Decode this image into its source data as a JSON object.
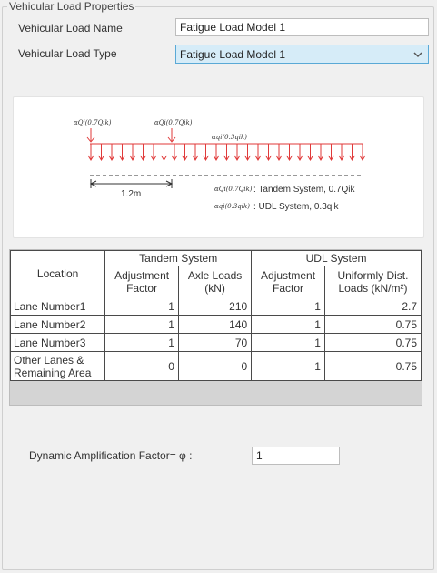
{
  "group": {
    "title": "Vehicular Load Properties"
  },
  "fields": {
    "name_label": "Vehicular Load Name",
    "name_value": "Fatigue Load Model 1",
    "type_label": "Vehicular Load Type",
    "type_value": "Fatigue Load Model 1"
  },
  "diagram": {
    "tandem_load_1": "αQi(0.7Qik)",
    "tandem_load_2": "αQi(0.7Qik)",
    "udl_load": "αqi(0.3qik)",
    "spacing": "1.2m",
    "legend_tandem_symbol": "αQi(0.7Qik)",
    "legend_tandem_text": ": Tandem System, 0.7Qik",
    "legend_udl_symbol": "αqi(0.3qik)",
    "legend_udl_text": ": UDL System, 0.3qik",
    "arrow_color": "#e03a3a"
  },
  "table": {
    "location_header": "Location",
    "tandem_header": "Tandem System",
    "udl_header": "UDL System",
    "sub_adj1": "Adjustment Factor",
    "sub_axle": "Axle Loads (kN)",
    "sub_adj2": "Adjustment Factor",
    "sub_udl": "Uniformly Dist. Loads (kN/m²)",
    "rows": [
      {
        "location": "Lane Number1",
        "tandem_adj": "1",
        "axle": "210",
        "udl_adj": "1",
        "udl": "2.7"
      },
      {
        "location": "Lane Number2",
        "tandem_adj": "1",
        "axle": "140",
        "udl_adj": "1",
        "udl": "0.75"
      },
      {
        "location": "Lane Number3",
        "tandem_adj": "1",
        "axle": "70",
        "udl_adj": "1",
        "udl": "0.75"
      },
      {
        "location": "Other Lanes & Remaining Area",
        "tandem_adj": "0",
        "axle": "0",
        "udl_adj": "1",
        "udl": "0.75"
      }
    ]
  },
  "daf": {
    "label": "Dynamic Amplification Factor= φ :",
    "value": "1"
  }
}
